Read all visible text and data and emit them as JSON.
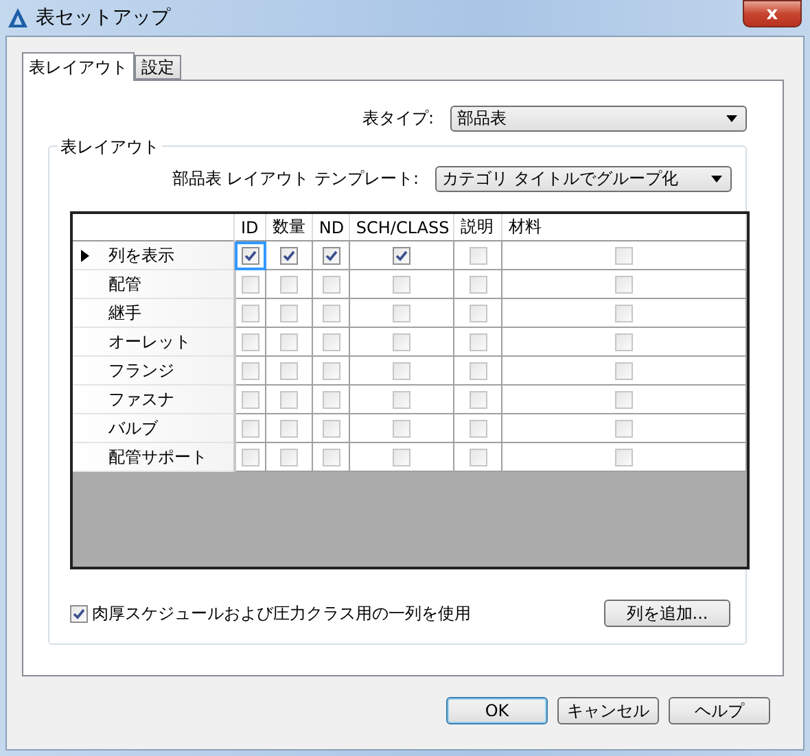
{
  "window": {
    "title": "表セットアップ",
    "close": "x"
  },
  "tabs": [
    {
      "label": "表レイアウト",
      "selected": true
    },
    {
      "label": "設定",
      "selected": false
    }
  ],
  "table_type": {
    "label": "表タイプ:",
    "value": "部品表"
  },
  "group": {
    "title": "表レイアウト",
    "template_label": "部品表 レイアウト テンプレート:",
    "template_value": "カテゴリ タイトルでグループ化",
    "columns": [
      "ID",
      "数量",
      "ND",
      "SCH/CLASS",
      "説明",
      "材料"
    ],
    "rows": [
      {
        "label": "列を表示",
        "selected": true,
        "cells": [
          true,
          true,
          true,
          true,
          false,
          false
        ]
      },
      {
        "label": "配管",
        "selected": false,
        "cells": [
          false,
          false,
          false,
          false,
          false,
          false
        ]
      },
      {
        "label": "継手",
        "selected": false,
        "cells": [
          false,
          false,
          false,
          false,
          false,
          false
        ]
      },
      {
        "label": "オーレット",
        "selected": false,
        "cells": [
          false,
          false,
          false,
          false,
          false,
          false
        ]
      },
      {
        "label": "フランジ",
        "selected": false,
        "cells": [
          false,
          false,
          false,
          false,
          false,
          false
        ]
      },
      {
        "label": "ファスナ",
        "selected": false,
        "cells": [
          false,
          false,
          false,
          false,
          false,
          false
        ]
      },
      {
        "label": "バルブ",
        "selected": false,
        "cells": [
          false,
          false,
          false,
          false,
          false,
          false
        ]
      },
      {
        "label": "配管サポート",
        "selected": false,
        "cells": [
          false,
          false,
          false,
          false,
          false,
          false
        ]
      }
    ],
    "option": {
      "label": "肉厚スケジュールおよび圧力クラス用の一列を使用",
      "checked": true
    },
    "add_button": "列を追加..."
  },
  "buttons": [
    {
      "label": "OK",
      "default": true
    },
    {
      "label": "キャンセル",
      "default": false
    },
    {
      "label": "ヘルプ",
      "default": false
    }
  ]
}
